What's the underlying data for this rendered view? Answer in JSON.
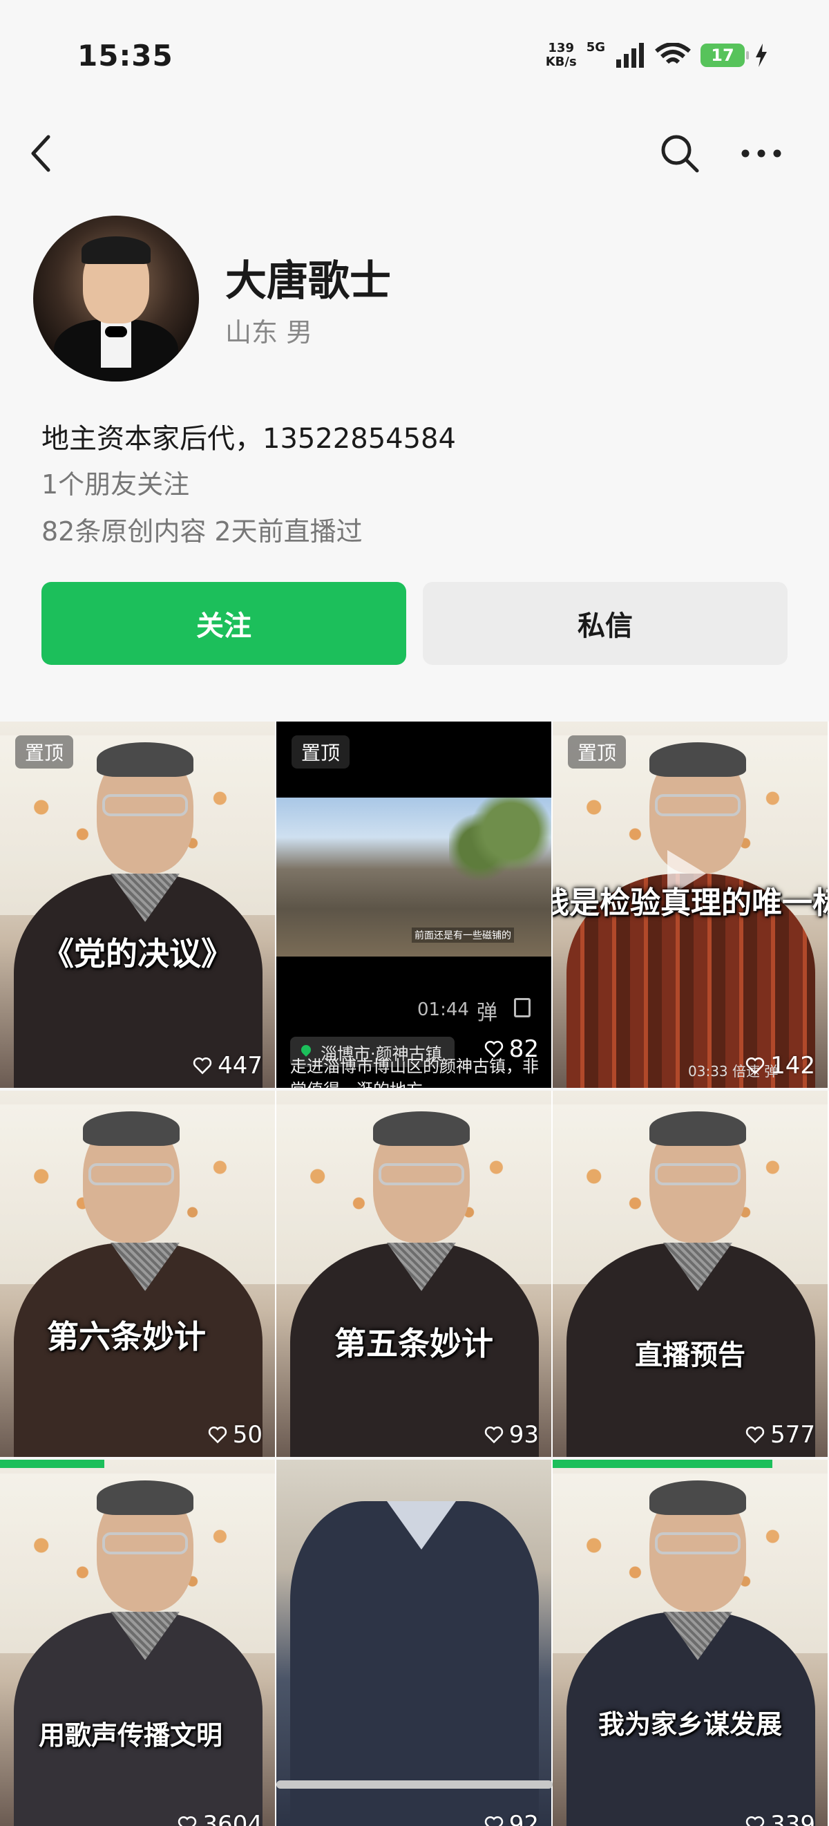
{
  "status_bar": {
    "time": "15:35",
    "net_speed_value": "139",
    "net_speed_unit": "KB/s",
    "network": "5G",
    "battery": "17",
    "icons": [
      "signal-icon",
      "wifi-icon",
      "battery-icon",
      "charging-icon"
    ]
  },
  "topbar": {
    "icons": [
      "back-icon",
      "search-icon",
      "more-icon"
    ]
  },
  "profile": {
    "name": "大唐歌士",
    "meta": "山东 男",
    "bio": "地主资本家后代，13522854584",
    "friends": "1个朋友关注",
    "stats": "82条原创内容  2天前直播过"
  },
  "actions": {
    "follow": "关注",
    "message": "私信"
  },
  "colors": {
    "accent": "#1cbf5b",
    "secondary_button": "#ececec"
  },
  "videos": [
    {
      "pin": "置顶",
      "title": "《党的决议》",
      "likes": "447"
    },
    {
      "pin": "置顶",
      "likes": "82",
      "caption": "前面还是有一些磁铺的",
      "video_time": "01:44",
      "danmu": "弹",
      "location": "淄博市·颜神古镇",
      "desc": "走进淄博市博山区的颜神古镇，非常值得一逛的地方。"
    },
    {
      "pin": "置顶",
      "title": "践是检验真理的唯一标",
      "likes": "142",
      "overlay": "03:33  倍速  弹"
    },
    {
      "title": "第六条妙计",
      "likes": "50",
      "progress": 0.38
    },
    {
      "title": "第五条妙计",
      "likes": "93"
    },
    {
      "title": "直播预告",
      "likes": "577",
      "progress": 0.8
    },
    {
      "title": "用歌声传播文明",
      "likes": "3604"
    },
    {
      "title": "",
      "likes": "92"
    },
    {
      "title": "我为家乡谋发展",
      "likes": "339"
    }
  ]
}
